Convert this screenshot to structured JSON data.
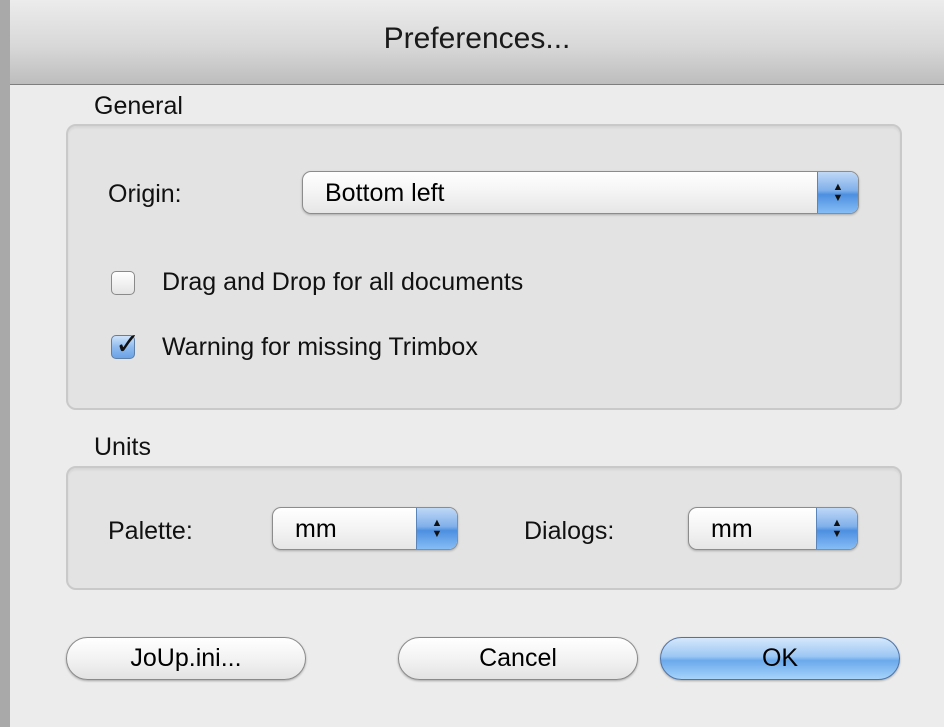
{
  "window": {
    "title": "Preferences..."
  },
  "general": {
    "label": "General",
    "origin_label": "Origin:",
    "origin_value": "Bottom left",
    "checkbox_drag_drop": {
      "label": "Drag and Drop for all documents",
      "checked": false
    },
    "checkbox_trimbox": {
      "label": "Warning for missing Trimbox",
      "checked": true
    }
  },
  "units": {
    "label": "Units",
    "palette_label": "Palette:",
    "palette_value": "mm",
    "dialogs_label": "Dialogs:",
    "dialogs_value": "mm"
  },
  "buttons": {
    "joup": "JoUp.ini...",
    "cancel": "Cancel",
    "ok": "OK"
  },
  "icons": {
    "popup_arrows": "up-down-arrows-icon",
    "checkmark": "checkmark-icon"
  },
  "colors": {
    "accent_blue": "#6aa9ec",
    "window_bg": "#ececec"
  }
}
